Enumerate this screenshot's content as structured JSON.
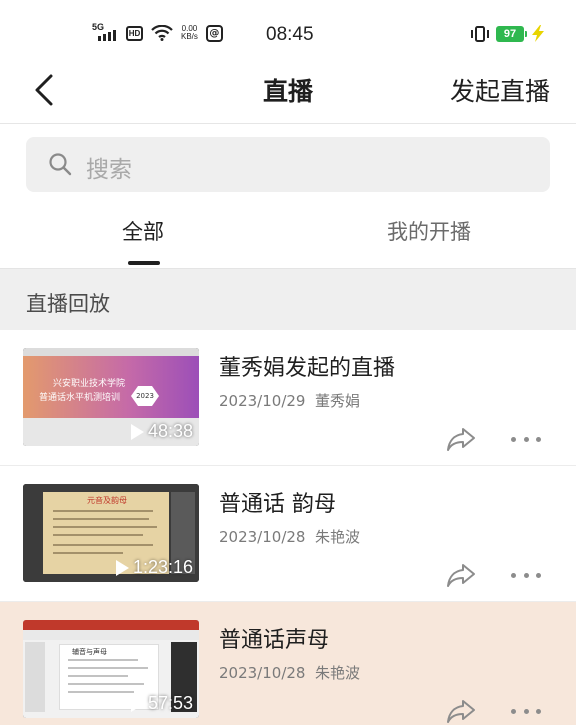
{
  "status_bar": {
    "network": "5G",
    "hd": "HD",
    "speed_value": "0.00",
    "speed_unit": "KB/s",
    "time": "08:45",
    "battery": "97"
  },
  "header": {
    "title": "直播",
    "action": "发起直播"
  },
  "search": {
    "placeholder": "搜索"
  },
  "tabs": [
    {
      "label": "全部",
      "active": true
    },
    {
      "label": "我的开播",
      "active": false
    }
  ],
  "section": {
    "title": "直播回放"
  },
  "items": [
    {
      "title": "董秀娟发起的直播",
      "date": "2023/10/29",
      "author": "董秀娟",
      "duration": "48:38",
      "thumb_line1": "兴安职业技术学院",
      "thumb_line2": "普通话水平机测培训",
      "thumb_badge": "2023",
      "highlighted": false
    },
    {
      "title": "普通话 韵母",
      "date": "2023/10/28",
      "author": "朱艳波",
      "duration": "1:23:16",
      "thumb_heading": "元音及韵母",
      "highlighted": false
    },
    {
      "title": "普通话声母",
      "date": "2023/10/28",
      "author": "朱艳波",
      "duration": "57:53",
      "thumb_heading": "辅音与声母",
      "highlighted": true
    }
  ],
  "colors": {
    "battery": "#2fb84f",
    "highlight_row": "#f7e7db",
    "section_bg": "#efefef"
  },
  "icons": [
    "signal-icon",
    "hd-icon",
    "wifi-icon",
    "at-icon",
    "vibrate-icon",
    "battery-icon",
    "charging-bolt-icon",
    "back-icon",
    "search-icon",
    "play-icon",
    "share-icon",
    "more-icon"
  ]
}
